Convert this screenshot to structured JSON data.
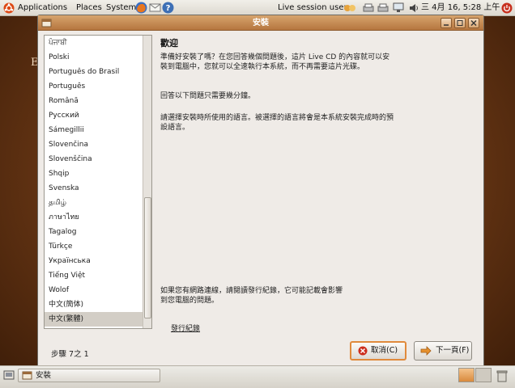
{
  "top_panel": {
    "applications": "Applications",
    "places": "Places",
    "system": "System",
    "user": "Live session user",
    "clock": "三 4月 16, 5:28 上午"
  },
  "window": {
    "title": "安裝",
    "languages": [
      {
        "label": "ਪੰਜਾਬੀ"
      },
      {
        "label": "Polski"
      },
      {
        "label": "Português do Brasil"
      },
      {
        "label": "Português"
      },
      {
        "label": "Română"
      },
      {
        "label": "Русский"
      },
      {
        "label": "Sámegillii"
      },
      {
        "label": "Slovenčina"
      },
      {
        "label": "Slovenščina"
      },
      {
        "label": "Shqip"
      },
      {
        "label": "Svenska"
      },
      {
        "label": "தமிழ்"
      },
      {
        "label": "ภาษาไทย"
      },
      {
        "label": "Tagalog"
      },
      {
        "label": "Türkçe"
      },
      {
        "label": "Українська"
      },
      {
        "label": "Tiếng Việt"
      },
      {
        "label": "Wolof"
      },
      {
        "label": "中文(簡体)"
      },
      {
        "label": "中文(繁體)",
        "selected": true
      }
    ],
    "welcome_title": "歡迎",
    "para1": "準備好安裝了嗎？在您回答幾個問題後，這片 Live CD 的內容就可以安裝到電腦中，您就可以全速執行本系統，而不再需要這片光碟。",
    "para2": "回答以下問題只需要幾分鐘。",
    "para3": "請選擇安裝時所使用的語言。被選擇的語言將會是本系統安裝完成時的預設語言。",
    "network_note": "如果您有網路連線，請閱讀發行紀錄，它可能記載會影響到您電腦的問題。",
    "release_notes_link": "發行紀錄",
    "step_label": "步驟 7之 1",
    "cancel_label": "取消(C)",
    "forward_label": "下一頁(F)"
  },
  "taskbar": {
    "task_label": "安裝"
  },
  "desktop": {
    "partial_text": "E"
  }
}
